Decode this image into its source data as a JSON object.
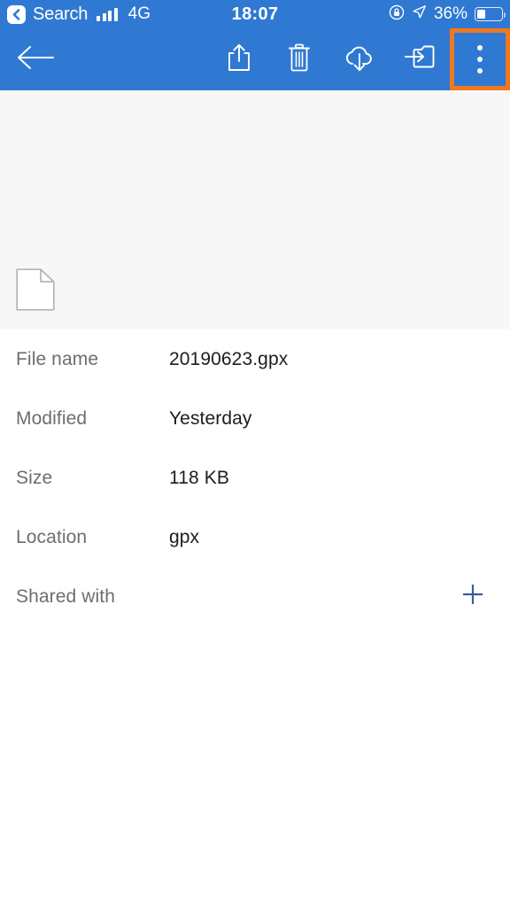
{
  "status_bar": {
    "back_chip_icon": "chevron-left-icon",
    "carrier_label": "Search",
    "signal_icon": "signal-bars-icon",
    "network": "4G",
    "time": "18:07",
    "rotation_lock_icon": "rotation-lock-icon",
    "location_icon": "location-arrow-icon",
    "battery_percent": "36%",
    "battery_level": 36,
    "background_color": "#3079d2",
    "foreground_color": "#ffffff"
  },
  "toolbar": {
    "back_icon": "arrow-left-icon",
    "background_color": "#3079d2",
    "highlight_color": "#f07820",
    "actions": [
      {
        "name": "share-button",
        "icon": "share-icon"
      },
      {
        "name": "delete-button",
        "icon": "trash-icon"
      },
      {
        "name": "download-button",
        "icon": "cloud-download-icon"
      },
      {
        "name": "move-button",
        "icon": "move-to-folder-icon"
      },
      {
        "name": "more-options-button",
        "icon": "overflow-menu-icon",
        "highlighted": true
      }
    ]
  },
  "preview": {
    "background_color": "#f7f7f7",
    "file_icon": "document-icon"
  },
  "details": {
    "rows": [
      {
        "label": "File name",
        "value": "20190623.gpx"
      },
      {
        "label": "Modified",
        "value": "Yesterday"
      },
      {
        "label": "Size",
        "value": "118 KB"
      },
      {
        "label": "Location",
        "value": "gpx"
      }
    ],
    "shared_with": {
      "label": "Shared with",
      "add_icon": "plus-icon",
      "add_color": "#3b5a9e"
    }
  }
}
